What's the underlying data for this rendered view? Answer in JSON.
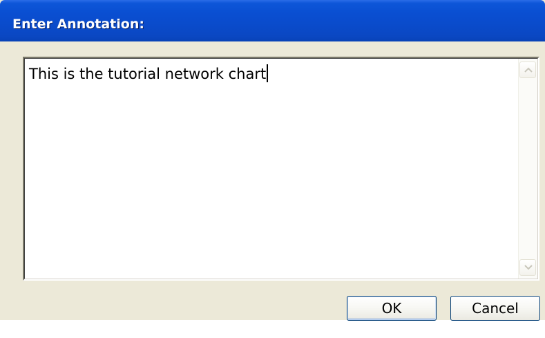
{
  "dialog": {
    "title": "Enter Annotation:",
    "annotation_text": "This is the tutorial network chart",
    "scroll_up_icon": "scroll-up-arrow",
    "scroll_down_icon": "scroll-down-arrow"
  },
  "buttons": {
    "ok_label": "OK",
    "cancel_label": "Cancel"
  },
  "colors": {
    "titlebar": "#0a4fd2",
    "dialog_background": "#ece9d8",
    "button_border": "#003c74"
  }
}
